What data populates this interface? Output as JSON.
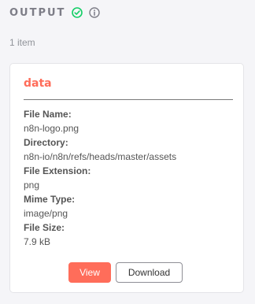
{
  "header": {
    "title": "OUTPUT",
    "success_icon": "check-circle-icon",
    "info_icon": "info-circle-icon"
  },
  "item_count": "1 item",
  "card": {
    "title": "data",
    "properties": [
      {
        "label": "File Name:",
        "value": "n8n-logo.png"
      },
      {
        "label": "Directory:",
        "value": "n8n-io/n8n/refs/heads/master/assets"
      },
      {
        "label": "File Extension:",
        "value": "png"
      },
      {
        "label": "Mime Type:",
        "value": "image/png"
      },
      {
        "label": "File Size:",
        "value": "7.9 kB"
      }
    ],
    "buttons": {
      "view_label": "View",
      "download_label": "Download"
    }
  },
  "colors": {
    "accent": "#ff6d5a",
    "success": "#13ce66",
    "muted": "#7d7d87"
  }
}
